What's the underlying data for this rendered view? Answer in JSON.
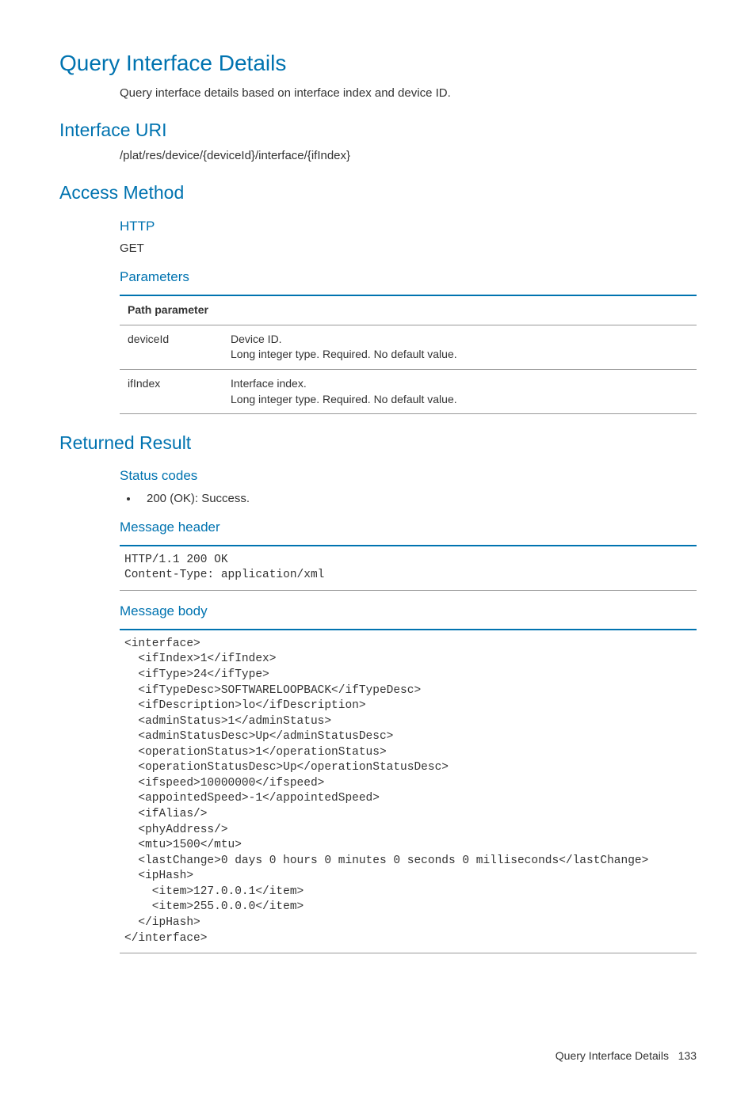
{
  "title": "Query Interface Details",
  "description": "Query interface details based on interface index and device ID.",
  "sections": {
    "interface_uri": {
      "heading": "Interface URI",
      "value": "/plat/res/device/{deviceId}/interface/{ifIndex}"
    },
    "access_method": {
      "heading": "Access Method",
      "http_label": "HTTP",
      "http_value": "GET",
      "parameters_label": "Parameters",
      "table_header": "Path parameter",
      "params": [
        {
          "name": "deviceId",
          "desc1": "Device ID.",
          "desc2": "Long integer type. Required. No default value."
        },
        {
          "name": "ifIndex",
          "desc1": "Interface index.",
          "desc2": "Long integer type. Required. No default value."
        }
      ]
    },
    "returned_result": {
      "heading": "Returned Result",
      "status_codes_label": "Status codes",
      "status_codes": [
        "200 (OK): Success."
      ],
      "message_header_label": "Message header",
      "message_header_code": "HTTP/1.1 200 OK\nContent-Type: application/xml",
      "message_body_label": "Message body",
      "message_body_code": "<interface>\n  <ifIndex>1</ifIndex>\n  <ifType>24</ifType>\n  <ifTypeDesc>SOFTWARELOOPBACK</ifTypeDesc>\n  <ifDescription>lo</ifDescription>\n  <adminStatus>1</adminStatus>\n  <adminStatusDesc>Up</adminStatusDesc>\n  <operationStatus>1</operationStatus>\n  <operationStatusDesc>Up</operationStatusDesc>\n  <ifspeed>10000000</ifspeed>\n  <appointedSpeed>-1</appointedSpeed>\n  <ifAlias/>\n  <phyAddress/>\n  <mtu>1500</mtu>\n  <lastChange>0 days 0 hours 0 minutes 0 seconds 0 milliseconds</lastChange>\n  <ipHash>\n    <item>127.0.0.1</item>\n    <item>255.0.0.0</item>\n  </ipHash>\n</interface>"
    }
  },
  "footer": {
    "label": "Query Interface Details",
    "page": "133"
  }
}
